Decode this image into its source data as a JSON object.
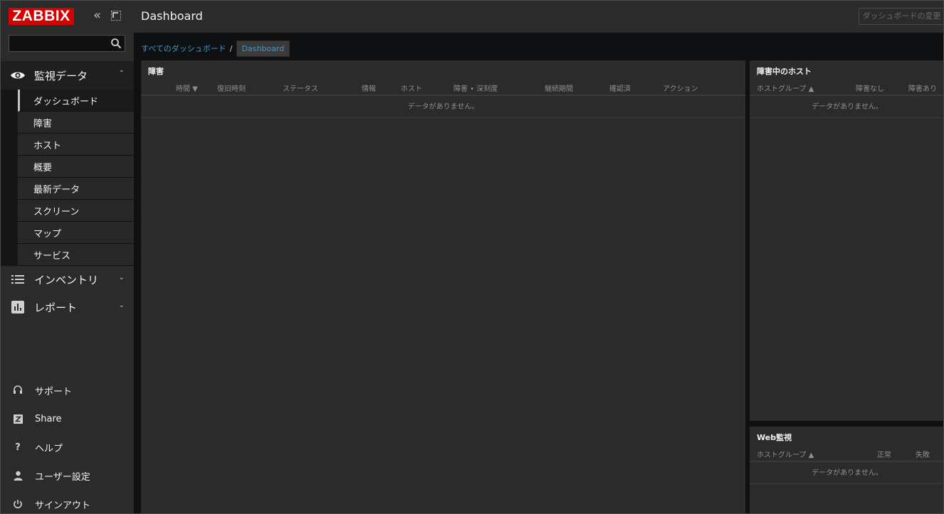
{
  "brand": {
    "logo_text": "ZABBIX",
    "accent": "#d40000",
    "link": "#4796c4"
  },
  "sidebar": {
    "search": {
      "placeholder": "",
      "value": ""
    },
    "monitoring": {
      "label": "監視データ",
      "icon": "eye-icon",
      "items": [
        {
          "label": "ダッシュボード",
          "active": true
        },
        {
          "label": "障害"
        },
        {
          "label": "ホスト"
        },
        {
          "label": "概要"
        },
        {
          "label": "最新データ"
        },
        {
          "label": "スクリーン"
        },
        {
          "label": "マップ"
        },
        {
          "label": "サービス"
        }
      ]
    },
    "inventory": {
      "label": "インベントリ",
      "icon": "list-icon"
    },
    "reports": {
      "label": "レポート",
      "icon": "bar-chart-icon"
    },
    "bottom": [
      {
        "label": "サポート",
        "icon": "headset-icon"
      },
      {
        "label": "Share",
        "icon": "share-z-icon"
      },
      {
        "label": "ヘルプ",
        "icon": "help-icon"
      },
      {
        "label": "ユーザー設定",
        "icon": "user-icon"
      },
      {
        "label": "サインアウト",
        "icon": "power-icon"
      }
    ]
  },
  "header": {
    "title": "Dashboard",
    "edit_button": "ダッシュボードの変更"
  },
  "breadcrumb": {
    "root": "すべてのダッシュボード",
    "separator": "/",
    "current": "Dashboard"
  },
  "widgets": {
    "problems": {
      "title": "障害",
      "columns": [
        "時間 ▼",
        "復旧時刻",
        "ステータス",
        "情報",
        "ホスト",
        "障害 • 深刻度",
        "継続期間",
        "確認済",
        "アクション"
      ],
      "empty": "データがありません。"
    },
    "hosts_with_problems": {
      "title": "障害中のホスト",
      "columns": [
        "ホストグループ ▲",
        "障害なし",
        "障害あり"
      ],
      "empty": "データがありません。"
    },
    "web_monitoring": {
      "title": "Web監視",
      "columns": [
        "ホストグループ ▲",
        "正常",
        "失敗"
      ],
      "empty": "データがありません。"
    }
  }
}
